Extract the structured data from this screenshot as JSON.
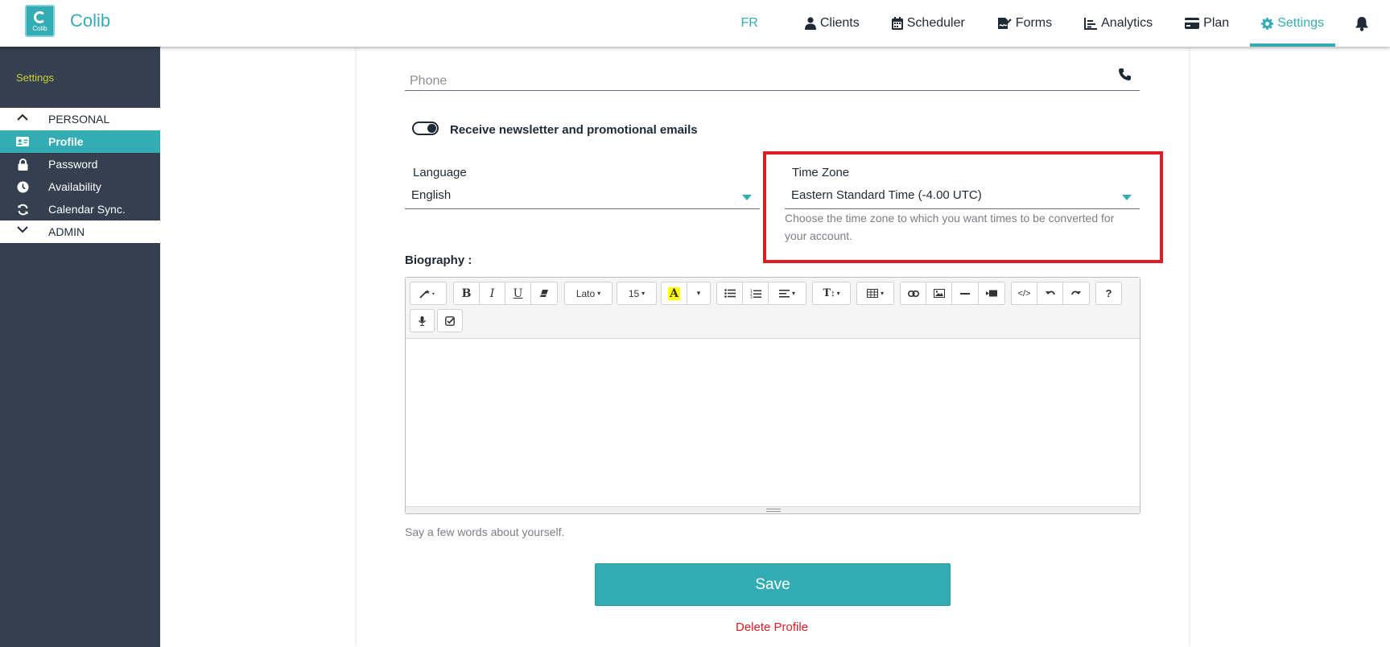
{
  "header": {
    "brand_name": "Colib",
    "logo_text": "Colib",
    "language_switch": "FR",
    "nav": [
      {
        "label": "Clients",
        "icon": "user-icon"
      },
      {
        "label": "Scheduler",
        "icon": "calendar-icon"
      },
      {
        "label": "Forms",
        "icon": "file-signature-icon"
      },
      {
        "label": "Analytics",
        "icon": "chart-icon"
      },
      {
        "label": "Plan",
        "icon": "credit-card-icon"
      },
      {
        "label": "Settings",
        "icon": "gear-icon",
        "active": true
      }
    ],
    "notifications_icon": "bell-icon"
  },
  "sidebar": {
    "title": "Settings",
    "groups": [
      {
        "label": "PERSONAL",
        "expanded": true,
        "icon": "chevron-up-icon"
      },
      {
        "label": "ADMIN",
        "expanded": false,
        "icon": "chevron-down-icon"
      }
    ],
    "items": [
      {
        "label": "Profile",
        "icon": "id-card-icon",
        "active": true
      },
      {
        "label": "Password",
        "icon": "lock-icon"
      },
      {
        "label": "Availability",
        "icon": "clock-icon"
      },
      {
        "label": "Calendar Sync.",
        "icon": "sync-icon"
      }
    ]
  },
  "form": {
    "phone": {
      "placeholder": "Phone",
      "icon": "phone-icon"
    },
    "newsletter": {
      "label": "Receive newsletter and promotional emails",
      "checked": true
    },
    "language": {
      "label": "Language",
      "value": "English"
    },
    "timezone": {
      "label": "Time Zone",
      "value": "Eastern Standard Time (-4.00 UTC)",
      "help": "Choose the time zone to which you want times to be converted for your account."
    },
    "biography": {
      "label": "Biography :",
      "help": "Say a few words about yourself.",
      "toolbar": {
        "font_name": "Lato",
        "font_size": "15",
        "buttons": [
          "magic-icon",
          "bold-icon",
          "italic-icon",
          "underline-icon",
          "eraser-icon",
          "font-color-icon",
          "unordered-list-icon",
          "ordered-list-icon",
          "align-icon",
          "line-height-icon",
          "table-icon",
          "link-icon",
          "image-icon",
          "hr-icon",
          "video-icon",
          "code-icon",
          "undo-icon",
          "redo-icon",
          "help-icon",
          "microphone-icon",
          "checkbox-icon"
        ]
      }
    },
    "save_label": "Save",
    "delete_label": "Delete Profile"
  },
  "colors": {
    "accent": "#33adb3",
    "sidebar_bg": "#343f4f",
    "sidebar_title": "#c9cd3b",
    "highlight": "#e01b24",
    "danger": "#e01b24"
  }
}
